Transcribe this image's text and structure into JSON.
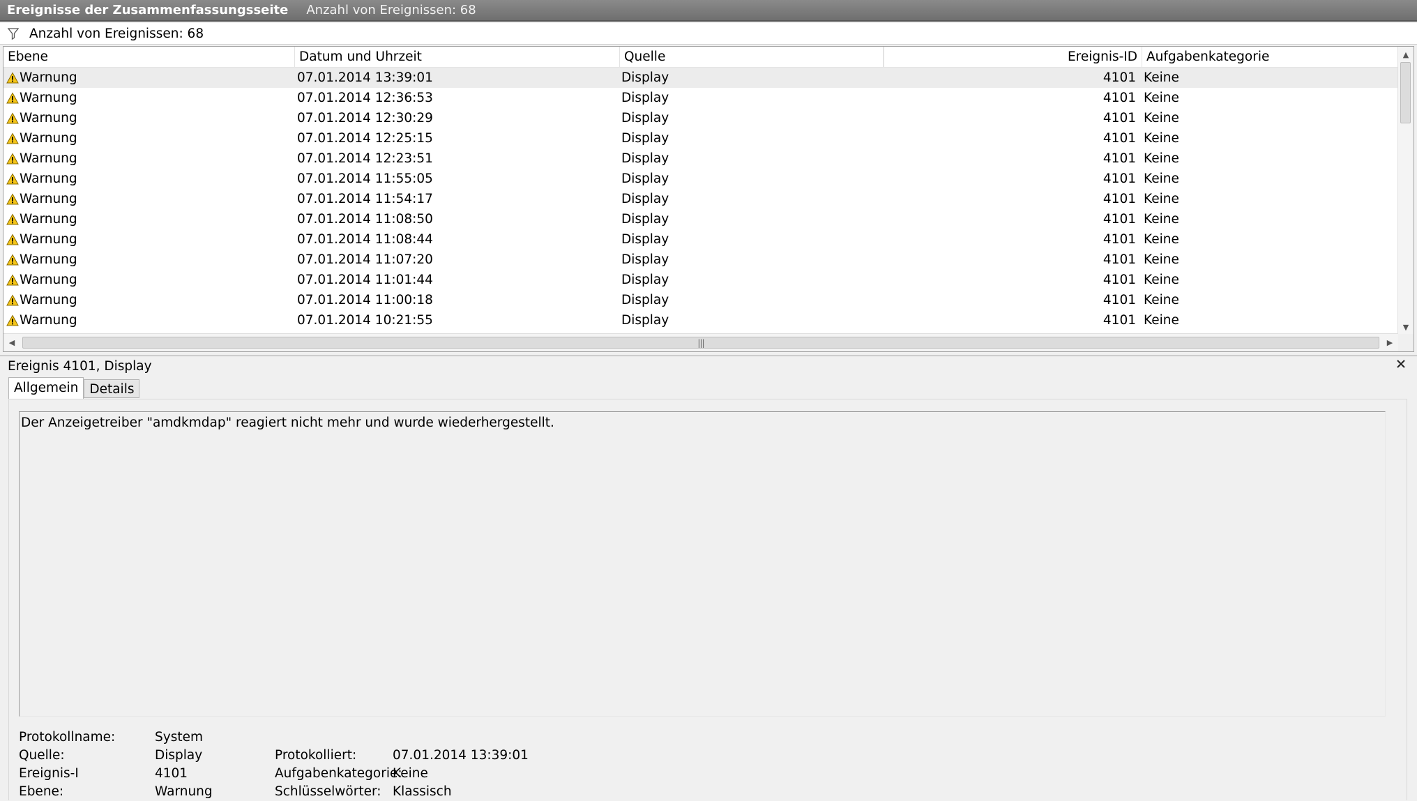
{
  "header": {
    "title": "Ereignisse der Zusammenfassungsseite",
    "count_label": "Anzahl von Ereignissen: 68"
  },
  "filter": {
    "label": "Anzahl von Ereignissen: 68",
    "icon": "filter-icon"
  },
  "grid": {
    "columns": [
      "Ebene",
      "Datum und Uhrzeit",
      "Quelle",
      "",
      "Ereignis-ID",
      "Aufgabenkategorie"
    ],
    "rows": [
      {
        "level": "Warnung",
        "datetime": "07.01.2014 13:39:01",
        "source": "Display",
        "id": "4101",
        "category": "Keine"
      },
      {
        "level": "Warnung",
        "datetime": "07.01.2014 12:36:53",
        "source": "Display",
        "id": "4101",
        "category": "Keine"
      },
      {
        "level": "Warnung",
        "datetime": "07.01.2014 12:30:29",
        "source": "Display",
        "id": "4101",
        "category": "Keine"
      },
      {
        "level": "Warnung",
        "datetime": "07.01.2014 12:25:15",
        "source": "Display",
        "id": "4101",
        "category": "Keine"
      },
      {
        "level": "Warnung",
        "datetime": "07.01.2014 12:23:51",
        "source": "Display",
        "id": "4101",
        "category": "Keine"
      },
      {
        "level": "Warnung",
        "datetime": "07.01.2014 11:55:05",
        "source": "Display",
        "id": "4101",
        "category": "Keine"
      },
      {
        "level": "Warnung",
        "datetime": "07.01.2014 11:54:17",
        "source": "Display",
        "id": "4101",
        "category": "Keine"
      },
      {
        "level": "Warnung",
        "datetime": "07.01.2014 11:08:50",
        "source": "Display",
        "id": "4101",
        "category": "Keine"
      },
      {
        "level": "Warnung",
        "datetime": "07.01.2014 11:08:44",
        "source": "Display",
        "id": "4101",
        "category": "Keine"
      },
      {
        "level": "Warnung",
        "datetime": "07.01.2014 11:07:20",
        "source": "Display",
        "id": "4101",
        "category": "Keine"
      },
      {
        "level": "Warnung",
        "datetime": "07.01.2014 11:01:44",
        "source": "Display",
        "id": "4101",
        "category": "Keine"
      },
      {
        "level": "Warnung",
        "datetime": "07.01.2014 11:00:18",
        "source": "Display",
        "id": "4101",
        "category": "Keine"
      },
      {
        "level": "Warnung",
        "datetime": "07.01.2014 10:21:55",
        "source": "Display",
        "id": "4101",
        "category": "Keine"
      }
    ],
    "selected_row": 0,
    "row_icon": "warning-icon"
  },
  "detail": {
    "title": "Ereignis 4101, Display",
    "tabs": [
      "Allgemein",
      "Details"
    ],
    "active_tab": "Allgemein",
    "message": "Der Anzeigetreiber \"amdkmdap\" reagiert nicht mehr und wurde wiederhergestellt.",
    "props": {
      "log_name_label": "Protokollname:",
      "log_name_value": "System",
      "source_label": "Quelle:",
      "source_value": "Display",
      "logged_label": "Protokolliert:",
      "logged_value": "07.01.2014 13:39:01",
      "event_id_label": "Ereignis-I",
      "event_id_value": "4101",
      "task_cat_label": "Aufgabenkategorie:",
      "task_cat_value": "Keine",
      "level_label": "Ebene:",
      "level_value": "Warnung",
      "keywords_label": "Schlüsselwörter:",
      "keywords_value": "Klassisch"
    }
  },
  "colors": {
    "titlebar": "#7a7a7a",
    "warning_fill": "#f5c518",
    "selection": "#ececec"
  }
}
